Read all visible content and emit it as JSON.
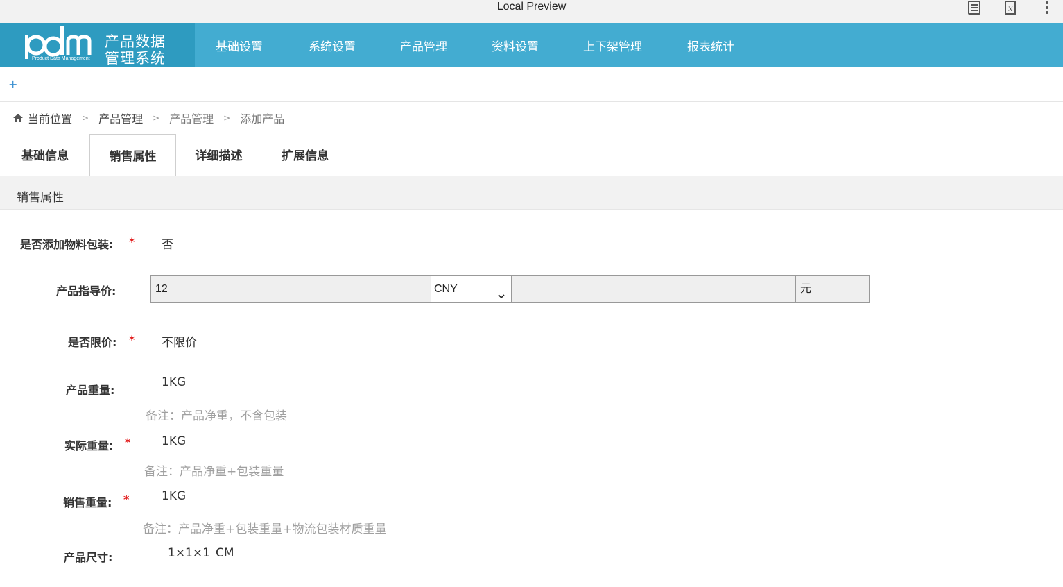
{
  "window": {
    "title": "Local Preview"
  },
  "logo": {
    "mark": "pdm",
    "brand_line1": "产品数据",
    "brand_line2": "管理系统",
    "tagline": "Product Data Management"
  },
  "nav": {
    "items": [
      "基础设置",
      "系统设置",
      "产品管理",
      "资料设置",
      "上下架管理",
      "报表统计"
    ]
  },
  "tabbar": {
    "add_label": "+"
  },
  "breadcrumb": {
    "items": [
      "当前位置",
      "产品管理",
      "产品管理",
      "添加产品"
    ],
    "separator": ">"
  },
  "tabs": {
    "items": [
      "基础信息",
      "销售属性",
      "详细描述",
      "扩展信息"
    ],
    "active_index": 1
  },
  "section": {
    "title": "销售属性"
  },
  "form": {
    "packaging": {
      "label": "是否添加物料包装:",
      "value": "否",
      "required": "*"
    },
    "guide_price": {
      "label": "产品指导价:",
      "value": "12",
      "currency": "CNY",
      "extra": "",
      "unit": "元"
    },
    "price_limit": {
      "label": "是否限价:",
      "value": "不限价",
      "required": "*"
    },
    "product_weight": {
      "label": "产品重量:",
      "value": "1KG",
      "note": "备注：产品净重，不含包装"
    },
    "actual_weight": {
      "label": "实际重量:",
      "value": "1KG",
      "required": "*",
      "note": "备注：产品净重+包装重量"
    },
    "sales_weight": {
      "label": "销售重量:",
      "value": "1KG",
      "required": "*",
      "note": "备注：产品净重+包装重量+物流包装材质重量"
    },
    "dimensions": {
      "label": "产品尺寸:",
      "value": "1×1×1",
      "unit": "CM"
    }
  },
  "colors": {
    "nav_bg": "#43acd1",
    "logo_bg": "#2e9bc0",
    "required": "#e21a1a",
    "note": "#a0a0a0"
  }
}
